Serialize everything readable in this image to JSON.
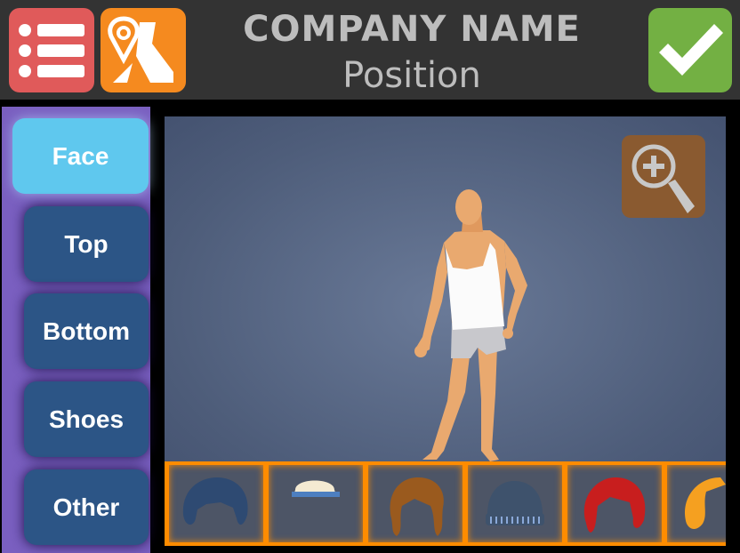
{
  "header": {
    "company_name": "COMPANY NAME",
    "position": "Position",
    "menu_icon": "list-icon",
    "map_icon": "map-pin-icon",
    "confirm_icon": "checkmark-icon"
  },
  "sidebar": {
    "items": [
      {
        "label": "Face",
        "active": true
      },
      {
        "label": "Top"
      },
      {
        "label": "Bottom"
      },
      {
        "label": "Shoes"
      },
      {
        "label": "Other"
      }
    ]
  },
  "stage": {
    "zoom_icon": "zoom-in-icon"
  },
  "items_bar": {
    "items": [
      {
        "name": "dark-blue-short-hair",
        "color": "#2e4a72"
      },
      {
        "name": "white-cap",
        "color": "#f0e0c0"
      },
      {
        "name": "brown-wavy-hair",
        "color": "#9a5a1e"
      },
      {
        "name": "beanie",
        "color": "#3e526c"
      },
      {
        "name": "red-bob-hair",
        "color": "#c81e1e"
      },
      {
        "name": "blonde-hair",
        "color": "#f5a020"
      }
    ]
  },
  "colors": {
    "header_bg": "#333333",
    "sidebar_bg": "#7a5fc0",
    "tab_bg": "#2c5586",
    "tab_active_bg": "#5fc8ee",
    "items_bar_bg": "#ff8c00",
    "menu_btn": "#e05a5a",
    "map_btn": "#f58a1f",
    "confirm_btn": "#73b043"
  }
}
